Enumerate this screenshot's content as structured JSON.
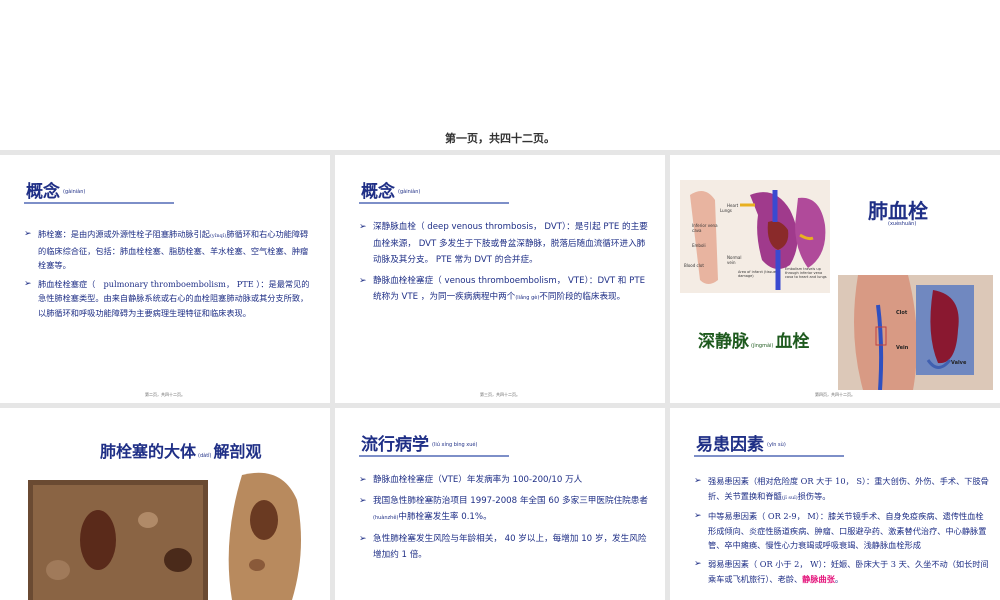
{
  "header": {
    "page_counter": "第一页，共四十二页。"
  },
  "slide1": {
    "title": "概念",
    "title_ruby": "(gàiniàn)",
    "items": [
      {
        "a": "肺栓塞：是由内源或外源性栓子阻塞肺动脉引起",
        "ruby": "(yǐnqǐ)",
        "b": "肺循环和右心功能障碍的临床综合征，包括：肺血栓栓塞、脂肪栓塞、羊水栓塞、空气栓塞、肿瘤栓塞等。"
      },
      {
        "a": "肺血栓栓塞症（　pulmonary thromboembolism， PTE ）：是最常见的急性肺栓塞类型。由来自静脉系统或右心的血栓阻塞肺动脉或其分支所致，以肺循环和呼吸功能障碍为主要病理生理特征和临床表现。"
      }
    ],
    "footer": "第二页，共四十二页。"
  },
  "slide2": {
    "title": "概念",
    "title_ruby": "(gàiniàn)",
    "items": [
      {
        "a": "深静脉血栓（ deep venous thrombosis， DVT）：是引起 PTE 的主要血栓来源， DVT 多发生于下肢或骨盆深静脉，脱落后随血流循环进入肺动脉及其分支。 PTE 常为 DVT 的合并症。"
      },
      {
        "a": "静脉血栓栓塞症（ venous thromboembolism， VTE）：DVT 和 PTE 统称为 VTE ，为同一疾病病程中两个",
        "ruby": "(liǎng gè)",
        "b": "不同阶段的临床表现。"
      }
    ],
    "footer": "第三页，共四十二页。"
  },
  "slide3": {
    "title_right": "肺血栓",
    "title_right_ruby": "(xuèshuān)",
    "title_left_a": "深静脉",
    "title_left_ruby": "(jìngmài)",
    "title_left_b": "血栓",
    "diagram_labels": [
      "Lungs",
      "Heart",
      "Inferior vena cava",
      "Emboli",
      "Normal vein",
      "Blood clot",
      "Area of infarct (tissue damage)",
      "Embolism travels up through inferior vena cava to heart and lungs"
    ],
    "leg_labels": [
      "Clot",
      "Vein",
      "Valve"
    ],
    "footer": "第四页，共四十二页。"
  },
  "slide4": {
    "title_a": "肺栓塞的大体",
    "title_ruby": "(dàtǐ)",
    "title_b": "解剖观"
  },
  "slide5": {
    "title": "流行病学",
    "title_ruby": "(liú xíng bìng xué)",
    "items": [
      {
        "a": "静脉血栓栓塞症（VTE）年发病率为 100-200/10 万人"
      },
      {
        "a": "我国急性肺栓塞防治项目 1997-2008 年全国 60 多家三甲医院住院患者",
        "ruby": "(huànzhě)",
        "b": "中肺栓塞发生率 0.1%。"
      },
      {
        "a": "急性肺栓塞发生风险与年龄相关， 40 岁以上，每增加 10 岁，发生风险增加约 1 倍。"
      }
    ]
  },
  "slide6": {
    "title": "易患因素",
    "title_ruby": "(yīn sù)",
    "items": [
      {
        "a": "强易患因素（相对危险度 OR 大于 10， S）：重大创伤、外伤、手术、下肢骨折、关节置换和脊髓",
        "ruby": "(jǐ suǐ)",
        "b": "损伤等。"
      },
      {
        "a": "中等易患因素（ OR 2-9， M）：膝关节镜手术、自身免疫疾病、遗传性血栓形成倾向、炎症性肠道疾病、肿瘤、口服避孕药、激素替代治疗、中心静脉置管、卒中瘫痪、慢性心力衰竭或呼吸衰竭、浅静脉血栓形成"
      },
      {
        "a": "弱易患因素（ OR 小于 2， W）：妊娠、卧床大于 3 天、久坐不动（如长时间乘车或飞机旅行）、老龄、",
        "highlight": "静脉曲张",
        "b": "。"
      }
    ]
  },
  "colors": {
    "title_blue": "#1f2f86",
    "green_title": "#1e5a1e",
    "highlight": "#e4127a",
    "rule": "#7d8fc8"
  }
}
